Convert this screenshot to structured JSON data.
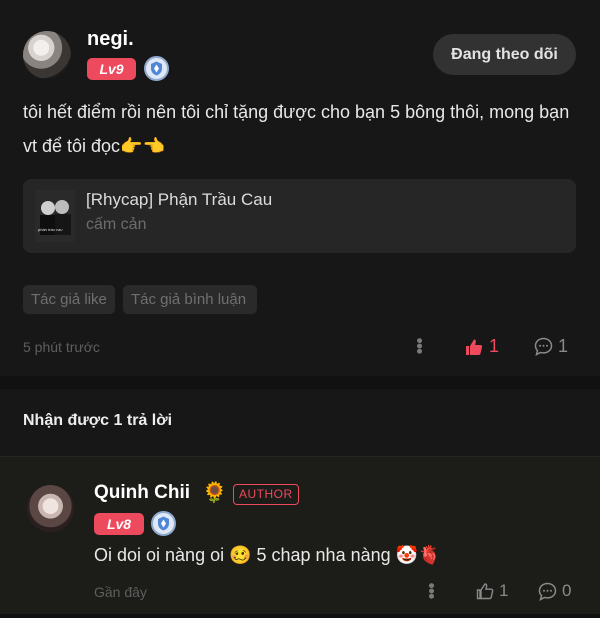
{
  "post": {
    "username": "negi.",
    "level": "Lv9",
    "follow_label": "Đang theo dõi",
    "text": "tôi hết điểm rồi nên tôi chỉ tặng được cho bạn 5 bông thôi, mong bạn vt để tôi đọc👉👈",
    "book": {
      "title": "[Rhycap] Phận Trầu Cau",
      "subtitle": "cấm cản",
      "cover_text": "phận trầu cau"
    },
    "tags": [
      "Tác giả like",
      "Tác giả bình luận"
    ],
    "time": "5 phút trước",
    "likes": "1",
    "replies": "1",
    "colors": {
      "accent": "#ee4a5d",
      "background": "#171717"
    }
  },
  "replies_header": "Nhận được 1 trả lời",
  "reply": {
    "username": "Quinh Chii",
    "flair": "🌻",
    "author_badge": "AUTHOR",
    "level": "Lv8",
    "text": "Oi doi oi nàng oi 🥴 5 chap nha nàng 🤡🫀",
    "time": "Gần đây",
    "likes": "1",
    "replies": "0"
  }
}
